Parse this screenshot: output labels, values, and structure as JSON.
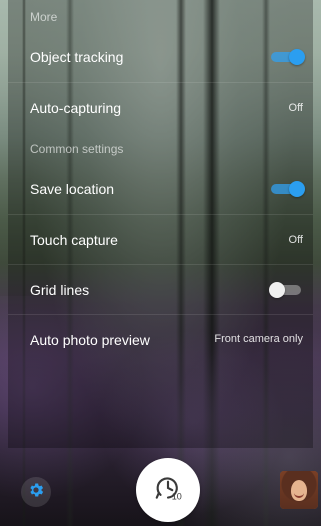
{
  "sections": [
    {
      "header": "More",
      "items": [
        {
          "label": "Object tracking",
          "control": {
            "type": "toggle",
            "on": true
          }
        },
        {
          "label": "Auto-capturing",
          "control": {
            "type": "value",
            "value": "Off"
          }
        }
      ]
    },
    {
      "header": "Common settings",
      "items": [
        {
          "label": "Save location",
          "control": {
            "type": "toggle",
            "on": true
          }
        },
        {
          "label": "Touch capture",
          "control": {
            "type": "value",
            "value": "Off"
          }
        },
        {
          "label": "Grid lines",
          "control": {
            "type": "toggle",
            "on": false
          }
        },
        {
          "label": "Auto photo preview",
          "control": {
            "type": "value",
            "value": "Front camera only"
          }
        }
      ]
    }
  ],
  "bottom_bar": {
    "settings_icon": "gear-icon",
    "shutter_icon": "timer-10s-icon",
    "timer_seconds": "10",
    "gallery_thumbnail": "avatar"
  },
  "colors": {
    "accent": "#2b9ef0"
  }
}
